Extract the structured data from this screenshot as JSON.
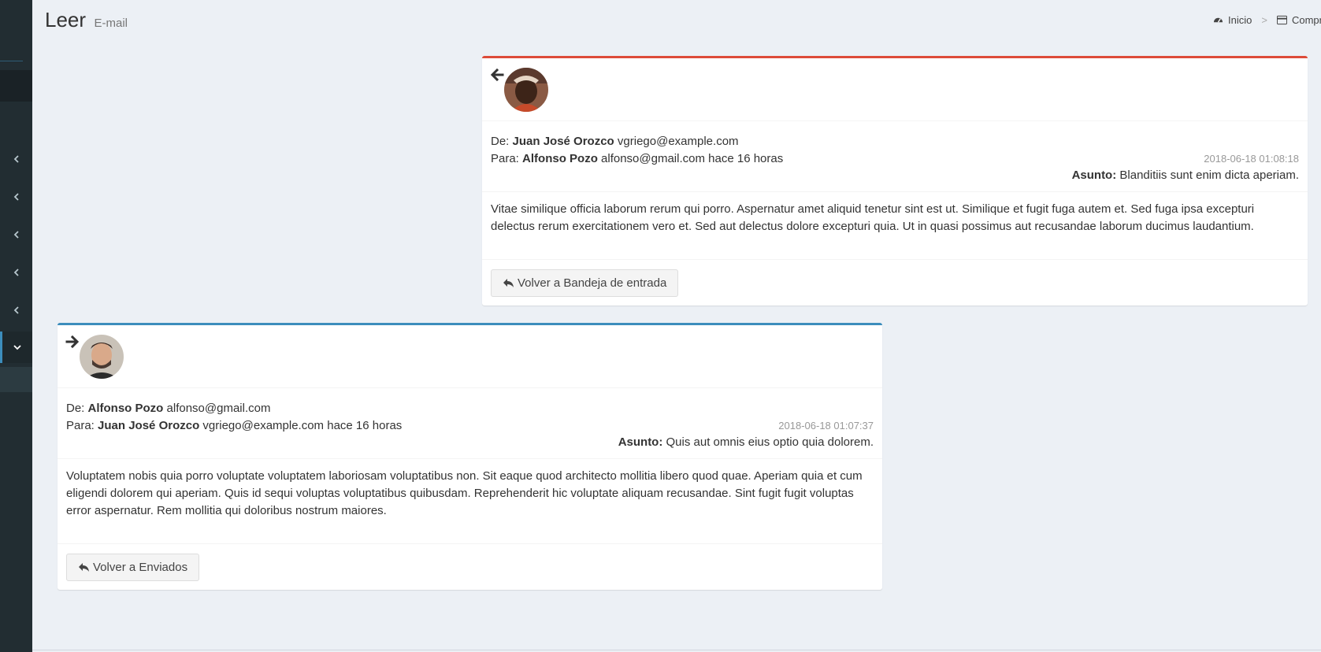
{
  "header": {
    "title": "Leer",
    "subtitle": "E-mail"
  },
  "breadcrumb": {
    "home": "Inicio",
    "separator": ">",
    "current": "Compra"
  },
  "messages": [
    {
      "direction": "received",
      "accent_color": "#dd4b39",
      "from_label": "De:",
      "from_name": "Juan José Orozco",
      "from_email": "vgriego@example.com",
      "to_label": "Para:",
      "to_name": "Alfonso Pozo",
      "to_email": "alfonso@gmail.com",
      "relative_time": "hace 16 horas",
      "date": "2018-06-18 01:08:18",
      "subject_label": "Asunto:",
      "subject": "Blanditiis sunt enim dicta aperiam.",
      "body": "Vitae similique officia laborum rerum qui porro. Aspernatur amet aliquid tenetur sint est ut. Similique et fugit fuga autem et. Sed fuga ipsa excepturi delectus rerum exercitationem vero et. Sed aut delectus dolore excepturi quia. Ut in quasi possimus aut recusandae laborum ducimus laudantium.",
      "back_button": "Volver a Bandeja de entrada"
    },
    {
      "direction": "sent",
      "accent_color": "#3c8dbc",
      "from_label": "De:",
      "from_name": "Alfonso Pozo",
      "from_email": "alfonso@gmail.com",
      "to_label": "Para:",
      "to_name": "Juan José Orozco",
      "to_email": "vgriego@example.com",
      "relative_time": "hace 16 horas",
      "date": "2018-06-18 01:07:37",
      "subject_label": "Asunto:",
      "subject": "Quis aut omnis eius optio quia dolorem.",
      "body": "Voluptatem nobis quia porro voluptate voluptatem laboriosam voluptatibus non. Sit eaque quod architecto mollitia libero quod quae. Aperiam quia et cum eligendi dolorem qui aperiam. Quis id sequi voluptas voluptatibus quibusdam. Reprehenderit hic voluptate aliquam recusandae. Sint fugit fugit voluptas error aspernatur. Rem mollitia qui doloribus nostrum maiores.",
      "back_button": "Volver a Enviados"
    }
  ],
  "icons": {
    "dashboard": "dashboard-icon",
    "card": "credit-card-icon",
    "arrow_left": "arrow-left-icon",
    "arrow_right": "arrow-right-icon",
    "reply": "reply-icon",
    "chevron_left": "chevron-left-icon",
    "chevron_down": "chevron-down-icon"
  },
  "colors": {
    "sidebar_bg": "#222d32",
    "page_bg": "#ecf0f5",
    "primary": "#3c8dbc",
    "danger": "#dd4b39"
  }
}
